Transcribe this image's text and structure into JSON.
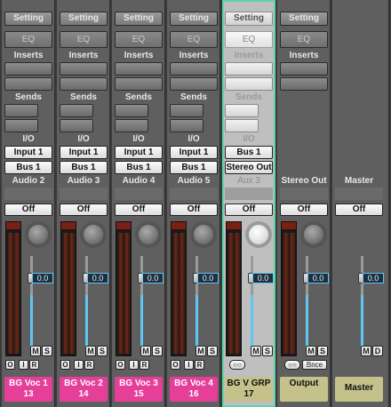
{
  "strips": [
    {
      "setting": "Setting",
      "eq": "EQ",
      "inserts": "Inserts",
      "sends": "Sends",
      "io": "I/O",
      "input": "Input 1",
      "output": "Bus 1",
      "name": "Audio 2",
      "automation": "Off",
      "volume": "0.0",
      "mute": "M",
      "solo": "S",
      "btn_o": "O",
      "btn_i": "I",
      "btn_r": "R",
      "label": "BG Voc 1",
      "number": "13",
      "color": "#e63f9a"
    },
    {
      "setting": "Setting",
      "eq": "EQ",
      "inserts": "Inserts",
      "sends": "Sends",
      "io": "I/O",
      "input": "Input 1",
      "output": "Bus 1",
      "name": "Audio 3",
      "automation": "Off",
      "volume": "0.0",
      "mute": "M",
      "solo": "S",
      "btn_o": "O",
      "btn_i": "I",
      "btn_r": "R",
      "label": "BG Voc 2",
      "number": "14",
      "color": "#e63f9a"
    },
    {
      "setting": "Setting",
      "eq": "EQ",
      "inserts": "Inserts",
      "sends": "Sends",
      "io": "I/O",
      "input": "Input 1",
      "output": "Bus 1",
      "name": "Audio 4",
      "automation": "Off",
      "volume": "0.0",
      "mute": "M",
      "solo": "S",
      "btn_o": "O",
      "btn_i": "I",
      "btn_r": "R",
      "label": "BG Voc 3",
      "number": "15",
      "color": "#e63f9a"
    },
    {
      "setting": "Setting",
      "eq": "EQ",
      "inserts": "Inserts",
      "sends": "Sends",
      "io": "I/O",
      "input": "Input 1",
      "output": "Bus 1",
      "name": "Audio 5",
      "automation": "Off",
      "volume": "0.0",
      "mute": "M",
      "solo": "S",
      "btn_o": "O",
      "btn_i": "I",
      "btn_r": "R",
      "label": "BG Voc 4",
      "number": "16",
      "color": "#e63f9a"
    },
    {
      "setting": "Setting",
      "eq": "EQ",
      "inserts": "Inserts",
      "sends": "Sends",
      "io": "I/O",
      "input": "Bus 1",
      "output": "Stereo Out",
      "name": "Aux 3",
      "automation": "Off",
      "volume": "0.0",
      "mute": "M",
      "solo": "S",
      "link": "○○",
      "label": "BG V GRP",
      "number": "17",
      "color": "#c4c18a",
      "selected": true
    },
    {
      "setting": "Setting",
      "eq": "EQ",
      "inserts": "Inserts",
      "name": "Stereo Out",
      "automation": "Off",
      "volume": "0.0",
      "mute": "M",
      "solo": "S",
      "link": "○○",
      "bounce": "Bnce",
      "label": "Output",
      "color": "#c4c18a"
    },
    {
      "name": "Master",
      "automation": "Off",
      "volume": "0.0",
      "mute": "M",
      "solo": "D",
      "label": "Master",
      "color": "#c4c18a"
    }
  ],
  "meter_levels": {
    "audio": 0.0,
    "aux": 0.0,
    "output": 0.0,
    "master": 0.0
  },
  "volume_fraction": 0.6,
  "accent_color": "#5fd4a6",
  "fader_readout_color": "#5ec8f2"
}
